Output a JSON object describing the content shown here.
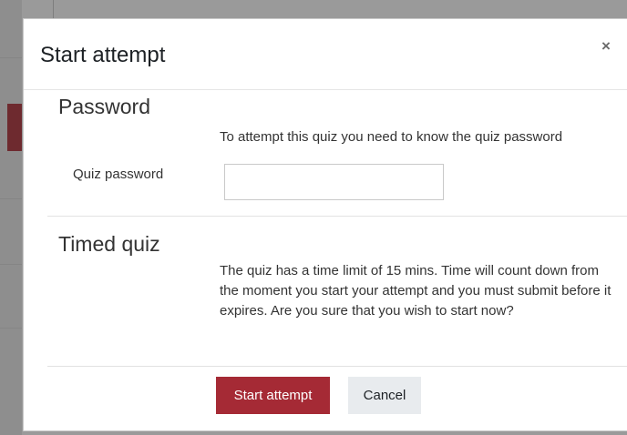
{
  "dialog": {
    "title": "Start attempt",
    "close_symbol": "×",
    "close_icon": "close-icon"
  },
  "password_section": {
    "heading": "Password",
    "description": "To attempt this quiz you need to know the quiz password",
    "field_label": "Quiz password",
    "field_value": ""
  },
  "timed_section": {
    "heading": "Timed quiz",
    "description": "The quiz has a time limit of 15 mins. Time will count down from the moment you start your attempt and you must submit before it expires. Are you sure that you wish to start now?"
  },
  "actions": {
    "start_label": "Start attempt",
    "cancel_label": "Cancel"
  },
  "colors": {
    "primary": "#a52a35",
    "secondary": "#e8ebee",
    "backdrop": "#8f8f8f"
  }
}
